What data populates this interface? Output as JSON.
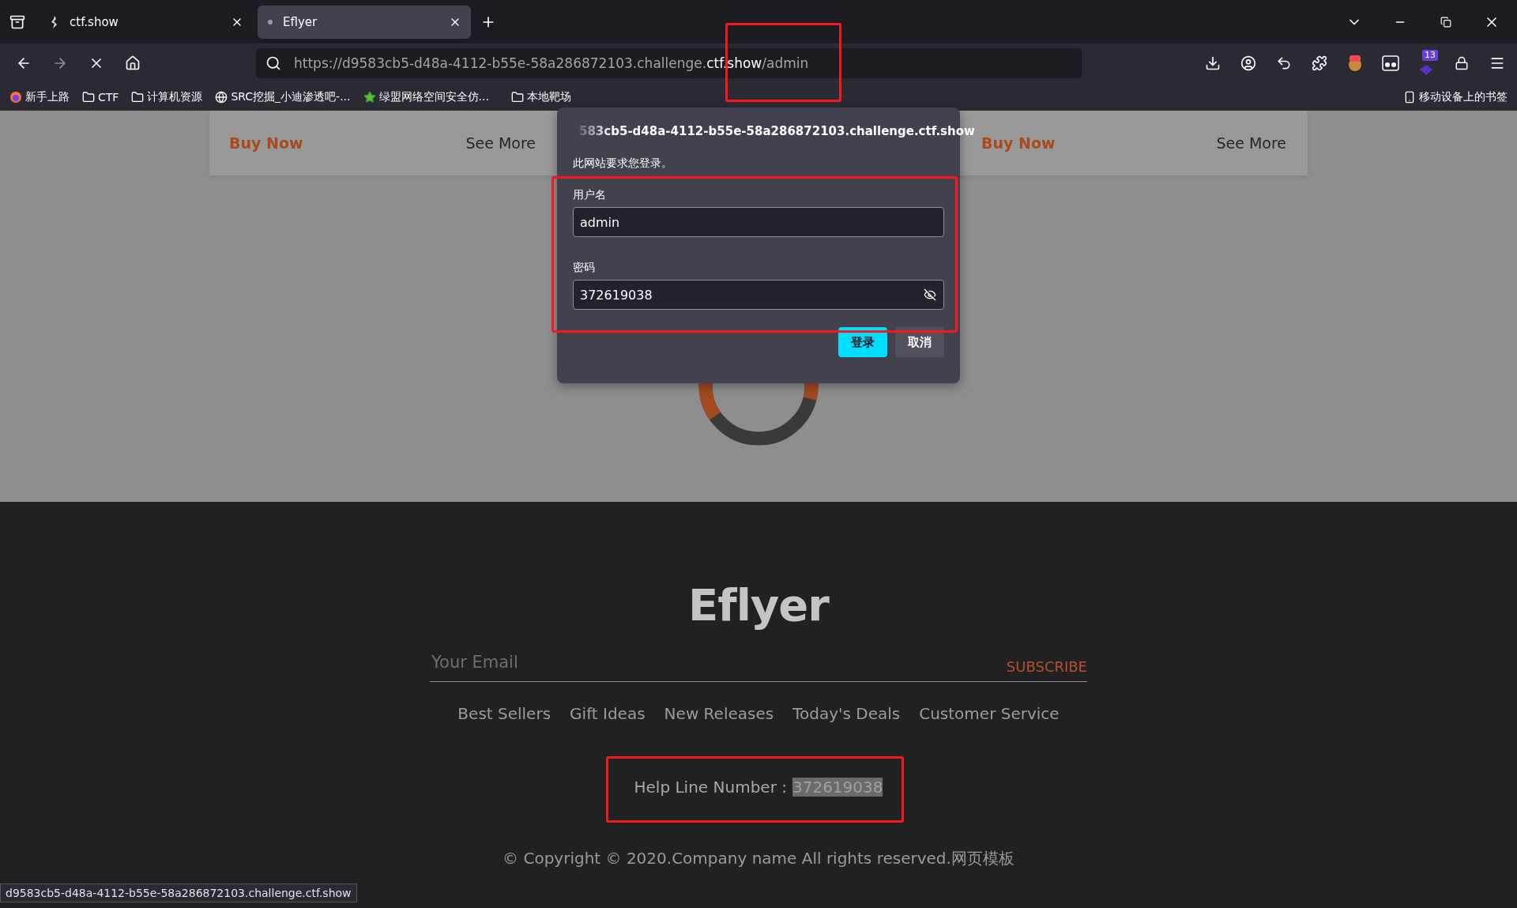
{
  "browser": {
    "tabs": [
      {
        "title": "ctf.show",
        "kind": "site",
        "selected": false
      },
      {
        "title": "Eflyer",
        "kind": "loading",
        "selected": true
      }
    ],
    "url": {
      "prefix": "https://d9583cb5-d48a-4112-b55e-58a286872103.challenge.",
      "domain": "ctf.show",
      "path": "/admin"
    },
    "extension_badge": "13",
    "bookmarks": [
      {
        "label": "新手上路",
        "kind": "firefox"
      },
      {
        "label": "CTF",
        "kind": "folder"
      },
      {
        "label": "计算机资源",
        "kind": "folder"
      },
      {
        "label": "SRC挖掘_小迪渗透吧-...",
        "kind": "globe"
      },
      {
        "label": "绿盟网络空间安全仿...",
        "kind": "star"
      },
      {
        "label": "本地靶场",
        "kind": "folder"
      }
    ],
    "mobile_bookmarks": "移动设备上的书签",
    "status": "d9583cb5-d48a-4112-b55e-58a286872103.challenge.ctf.show"
  },
  "page": {
    "cards": [
      {
        "buy": "Buy Now",
        "more": "See More"
      },
      {
        "buy": "Buy Now",
        "more": "See More"
      }
    ],
    "footer": {
      "logo": "Eflyer",
      "email_placeholder": "Your Email",
      "subscribe": "SUBSCRIBE",
      "links": [
        "Best Sellers",
        "Gift Ideas",
        "New Releases",
        "Today's Deals",
        "Customer Service"
      ],
      "help_label": "Help Line Number :",
      "help_number": "372619038",
      "copyright": "© Copyright © 2020.Company name All rights reserved.网页模板"
    }
  },
  "dialog": {
    "host": "583cb5-d48a-4112-b55e-58a286872103.challenge.ctf.show",
    "message": "此网站要求您登录。",
    "username_label": "用户名",
    "username": "admin",
    "password_label": "密码",
    "password": "372619038",
    "password_revealed": true,
    "login": "登录",
    "cancel": "取消"
  }
}
